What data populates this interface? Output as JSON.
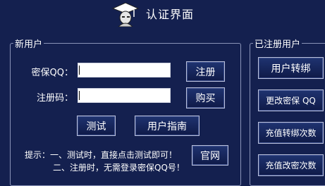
{
  "window": {
    "title": "认证界面"
  },
  "new_user": {
    "legend": "新用户",
    "fields": {
      "qq_label": "密保QQ：",
      "qq_value": "",
      "code_label": "注册码：",
      "code_value": ""
    },
    "buttons": {
      "register": "注册",
      "buy": "购买",
      "test": "测试",
      "guide": "用户指南",
      "website": "官网"
    },
    "tips": {
      "line1": "提示：一、测试时，直接点击测试即可！",
      "line2": "二、注册时，无需登录密保QQ号！"
    }
  },
  "registered_user": {
    "legend": "已注册用户",
    "buttons": {
      "transfer": "用户转绑",
      "change_qq": "更改密保 QQ",
      "recharge_transfer": "充值转绑次数",
      "recharge_change": "充值改密次数"
    }
  },
  "colors": {
    "background": "#14204f",
    "button": "#1a2a60",
    "border": "#b9c0db"
  }
}
